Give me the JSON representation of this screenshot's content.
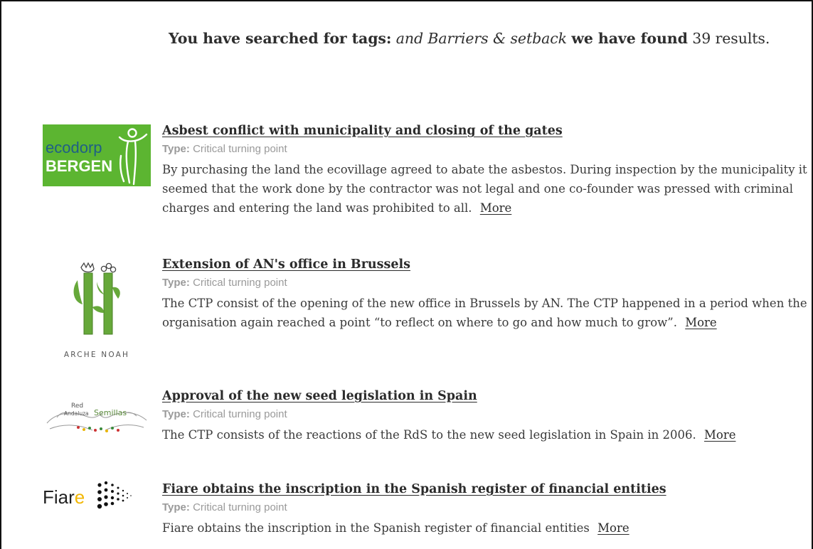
{
  "summary": {
    "prefix": "You have searched for tags:",
    "tags": "and Barriers & setback",
    "found_label": "we have found",
    "count": "39",
    "results_label": "results."
  },
  "results": [
    {
      "logo_text_top": "ecodorp",
      "logo_text_bottom": "BERGEN",
      "title": "Asbest conflict with municipality and closing of the gates",
      "type_label": "Type:",
      "type_value": "Critical turning point",
      "description": "By purchasing the land the ecovillage agreed to abate the asbestos. During inspection by the municipality it seemed that the work done by the contractor was not legal and one co-founder was pressed with criminal charges and entering the land was prohibited to all.",
      "more_label": "More"
    },
    {
      "logo_text": "ARCHE NOAH",
      "title": "Extension of AN's office in Brussels",
      "type_label": "Type:",
      "type_value": "Critical turning point",
      "description": "The CTP consist of the opening of the new office in Brussels by AN. The CTP happened in a period when the organisation again reached a point “to reflect on where to go and how much to grow”.",
      "more_label": "More"
    },
    {
      "logo_text_1": "Red",
      "logo_text_2": "Andaluza",
      "logo_text_3": "Semillas",
      "title": "Approval of the new seed legislation in Spain",
      "type_label": "Type:",
      "type_value": "Critical turning point",
      "description": "The CTP consists of the reactions of the RdS to the new seed legislation in Spain in 2006.",
      "more_label": "More"
    },
    {
      "logo_text_main": "Fiar",
      "logo_text_accent": "e",
      "title": "Fiare obtains the inscription in the Spanish register of financial entities",
      "type_label": "Type:",
      "type_value": "Critical turning point",
      "description": "Fiare obtains the inscription in the Spanish register of financial entities",
      "more_label": "More"
    }
  ],
  "colors": {
    "ecodorp_green": "#5cb531",
    "archenoah_green": "#66a83a",
    "fiare_yellow": "#f2b705"
  }
}
